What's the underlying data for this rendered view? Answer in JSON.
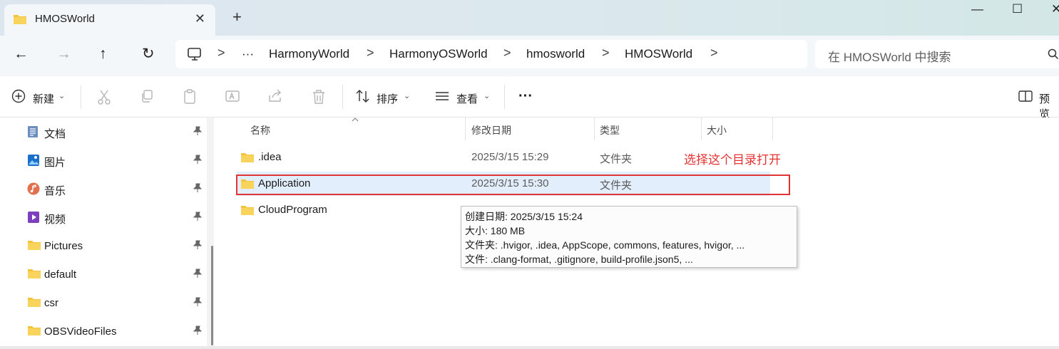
{
  "tab": {
    "title": "HMOSWorld",
    "close": "✕",
    "new_tab": "+"
  },
  "window_controls": {
    "minimize": "—",
    "maximize": "☐",
    "close": "✕"
  },
  "nav": {
    "back": "←",
    "forward": "→",
    "up": "↑",
    "refresh": "↻"
  },
  "address": {
    "more": "···",
    "breadcrumbs": [
      "HarmonyWorld",
      "HarmonyOSWorld",
      "hmosworld",
      "HMOSWorld"
    ],
    "separator": ">"
  },
  "search": {
    "placeholder": "在 HMOSWorld 中搜索"
  },
  "toolbar": {
    "new_label": "新建",
    "sort_label": "排序",
    "view_label": "查看",
    "more_label": "···",
    "preview_label": "预览"
  },
  "sidebar": {
    "items": [
      {
        "label": "文档",
        "icon": "document-icon"
      },
      {
        "label": "图片",
        "icon": "pictures-icon"
      },
      {
        "label": "音乐",
        "icon": "music-icon"
      },
      {
        "label": "视频",
        "icon": "video-icon"
      },
      {
        "label": "Pictures",
        "icon": "folder-icon"
      },
      {
        "label": "default",
        "icon": "folder-icon"
      },
      {
        "label": "csr",
        "icon": "folder-icon"
      },
      {
        "label": "OBSVideoFiles",
        "icon": "folder-icon"
      }
    ]
  },
  "columns": {
    "name": "名称",
    "modified": "修改日期",
    "type": "类型",
    "size": "大小"
  },
  "files": [
    {
      "name": ".idea",
      "modified": "2025/3/15 15:29",
      "type": "文件夹"
    },
    {
      "name": "Application",
      "modified": "2025/3/15 15:30",
      "type": "文件夹"
    },
    {
      "name": "CloudProgram",
      "modified": "",
      "type": ""
    }
  ],
  "annotation": "选择这个目录打开",
  "tooltip": {
    "created": "创建日期: 2025/3/15 15:24",
    "size": "大小: 180 MB",
    "folders": "文件夹: .hvigor, .idea, AppScope, commons, features, hvigor, ...",
    "files": "文件: .clang-format, .gitignore, build-profile.json5, ..."
  },
  "colors": {
    "folder": "#f3c33c",
    "accent": "#0067c0",
    "annotation": "#e53333",
    "selection": "#e2eefb"
  }
}
